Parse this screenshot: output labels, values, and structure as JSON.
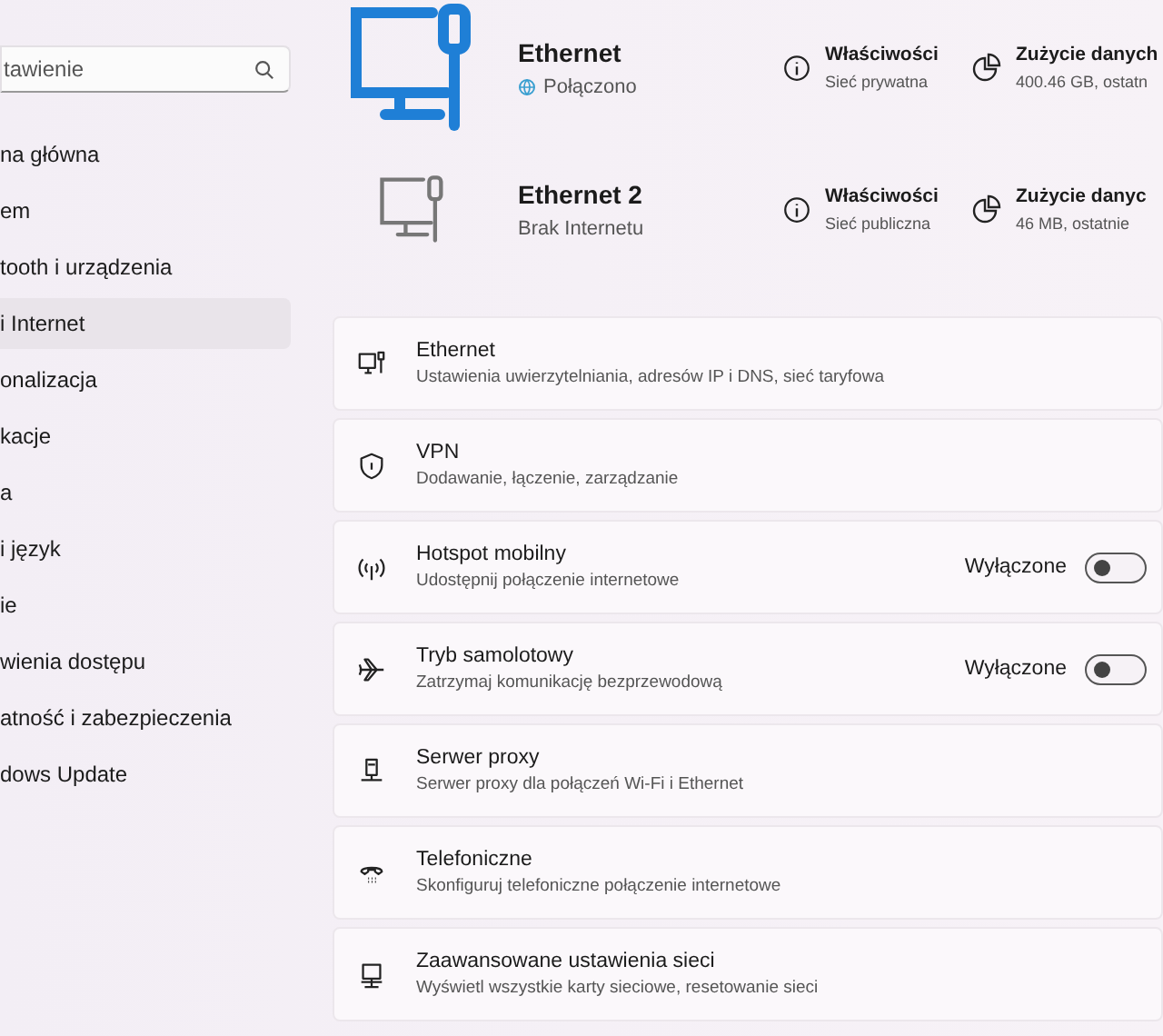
{
  "search": {
    "placeholder": "tawienie"
  },
  "sidebar": {
    "items": [
      {
        "label": "na główna",
        "selected": false
      },
      {
        "label": "em",
        "selected": false
      },
      {
        "label": "tooth i urządzenia",
        "selected": false
      },
      {
        "label": "i Internet",
        "selected": true
      },
      {
        "label": "onalizacja",
        "selected": false
      },
      {
        "label": "kacje",
        "selected": false
      },
      {
        "label": "a",
        "selected": false
      },
      {
        "label": "i język",
        "selected": false
      },
      {
        "label": "ie",
        "selected": false
      },
      {
        "label": "wienia dostępu",
        "selected": false
      },
      {
        "label": "atność i zabezpieczenia",
        "selected": false
      },
      {
        "label": "dows Update",
        "selected": false
      }
    ]
  },
  "adapters": [
    {
      "name": "Ethernet",
      "status": "Połączono",
      "connected": true,
      "properties_title": "Właściwości",
      "network_type": "Sieć prywatna",
      "usage_title": "Zużycie danych",
      "usage": "400.46 GB, ostatn"
    },
    {
      "name": "Ethernet 2",
      "status": "Brak Internetu",
      "connected": false,
      "properties_title": "Właściwości",
      "network_type": "Sieć publiczna",
      "usage_title": "Zużycie danyc",
      "usage": "46 MB, ostatnie"
    }
  ],
  "settings": [
    {
      "kind": "link",
      "title": "Ethernet",
      "subtitle": "Ustawienia uwierzytelniania, adresów IP i DNS, sieć taryfowa"
    },
    {
      "kind": "link",
      "title": "VPN",
      "subtitle": "Dodawanie, łączenie, zarządzanie"
    },
    {
      "kind": "toggle",
      "title": "Hotspot mobilny",
      "subtitle": "Udostępnij połączenie internetowe",
      "state_label": "Wyłączone",
      "on": false
    },
    {
      "kind": "toggle",
      "title": "Tryb samolotowy",
      "subtitle": "Zatrzymaj komunikację bezprzewodową",
      "state_label": "Wyłączone",
      "on": false
    },
    {
      "kind": "link",
      "title": "Serwer proxy",
      "subtitle": "Serwer proxy dla połączeń Wi-Fi i Ethernet"
    },
    {
      "kind": "link",
      "title": "Telefoniczne",
      "subtitle": "Skonfiguruj telefoniczne połączenie internetowe"
    },
    {
      "kind": "link",
      "title": "Zaawansowane ustawienia sieci",
      "subtitle": "Wyświetl wszystkie karty sieciowe, resetowanie sieci"
    }
  ]
}
